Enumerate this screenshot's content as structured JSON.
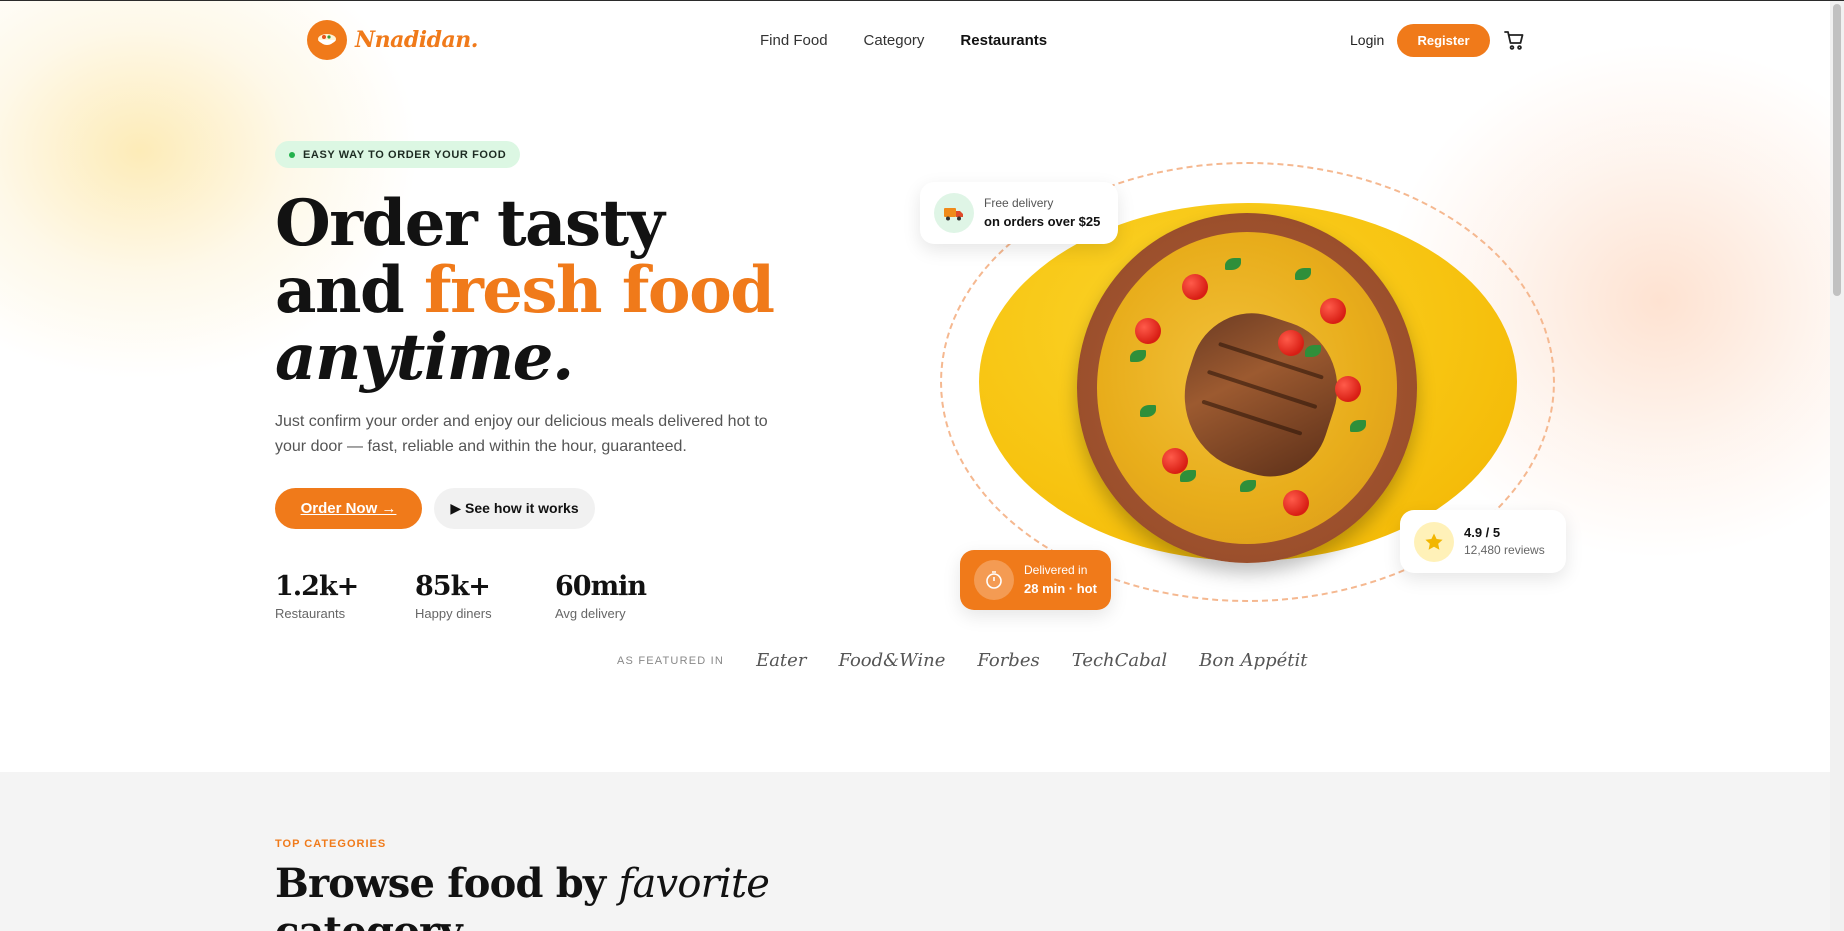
{
  "brand": {
    "name": "Nnadidan.",
    "accent": "#f07a1a"
  },
  "nav": {
    "items": [
      {
        "label": "Find Food",
        "active": false
      },
      {
        "label": "Category",
        "active": false
      },
      {
        "label": "Restaurants",
        "active": true
      }
    ]
  },
  "auth": {
    "login": "Login",
    "register": "Register"
  },
  "hero": {
    "pill": "EASY WAY TO ORDER YOUR FOOD",
    "title_line1": "Order tasty",
    "title_line2_a": "and ",
    "title_line2_b": "fresh food",
    "title_line3": "anytime.",
    "subtitle": "Just confirm your order and enjoy our delicious meals delivered hot to your door — fast, reliable and within the hour, guaranteed.",
    "cta_primary": "Order Now →",
    "cta_secondary": "▶ See how it works"
  },
  "stats": [
    {
      "value": "1.2k+",
      "label": "Restaurants"
    },
    {
      "value": "85k+",
      "label": "Happy diners"
    },
    {
      "value": "60min",
      "label": "Avg delivery"
    }
  ],
  "featured": {
    "label": "AS FEATURED IN",
    "brands": [
      "Eater",
      "Food&Wine",
      "Forbes",
      "TechCabal",
      "Bon Appétit"
    ]
  },
  "cards": {
    "delivery": {
      "line1": "Free delivery",
      "line2": "on orders over $25",
      "icon": "truck-icon"
    },
    "time": {
      "line1": "Delivered in",
      "line2": "28 min · hot",
      "icon": "stopwatch-icon"
    },
    "rating": {
      "line1": "4.9 / 5",
      "line2": "12,480 reviews",
      "icon": "star-icon"
    }
  },
  "categories_section": {
    "eyebrow": "TOP CATEGORIES",
    "title_a": "Browse food by ",
    "title_b": "favorite",
    "title_c": "category"
  }
}
